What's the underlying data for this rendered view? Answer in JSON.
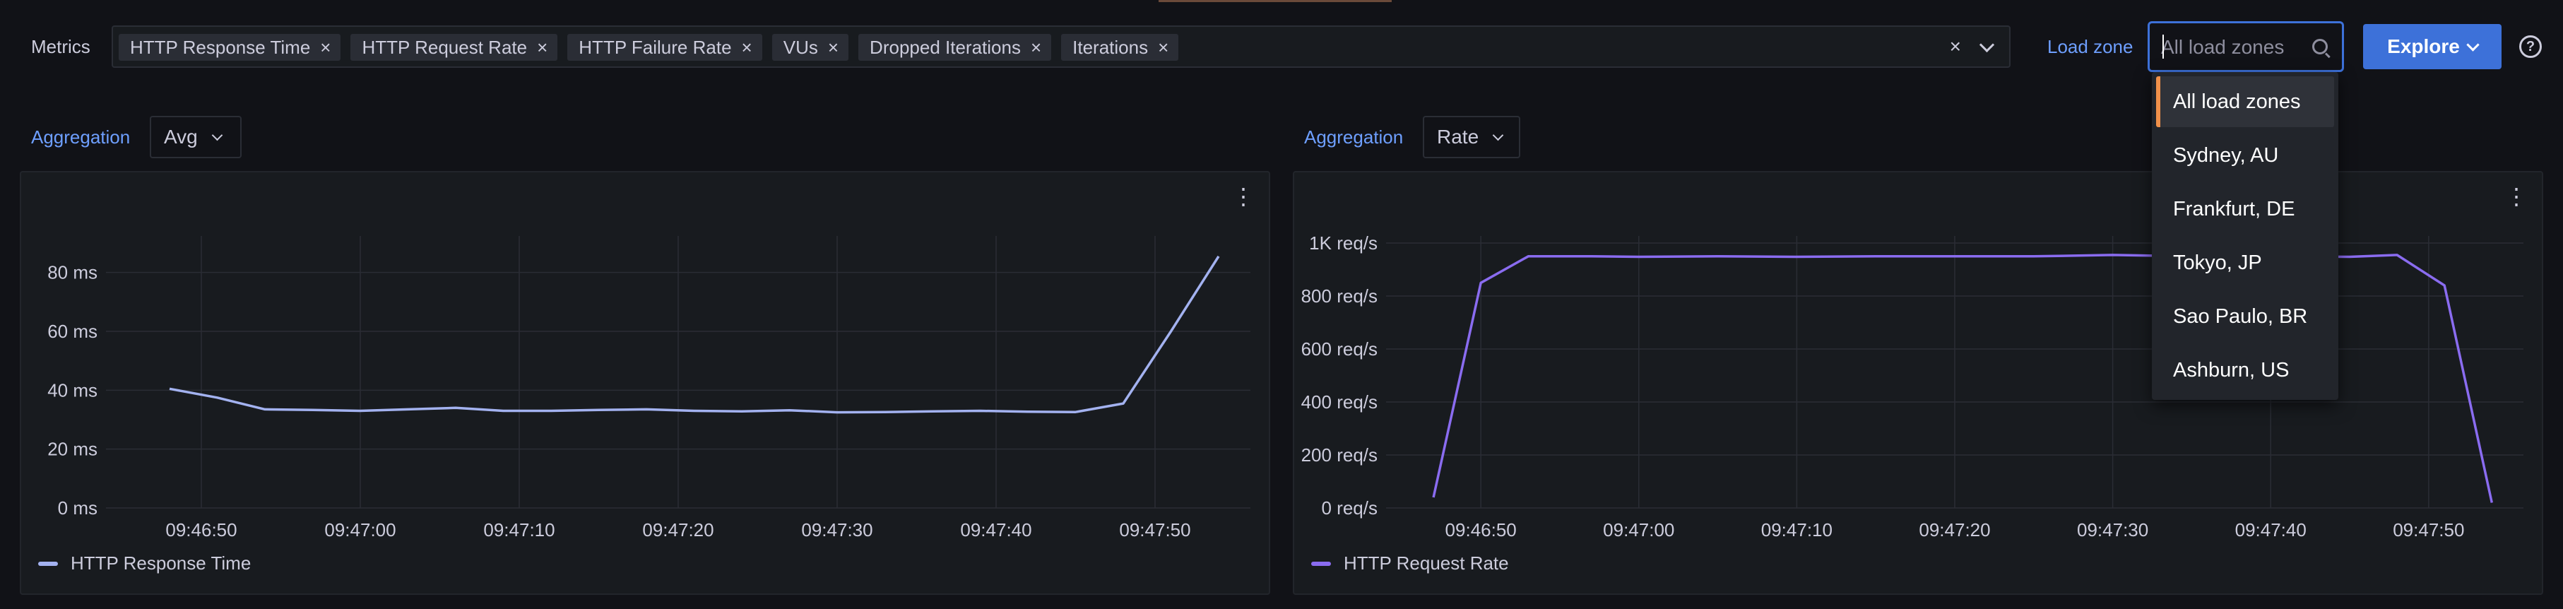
{
  "metrics": {
    "label": "Metrics",
    "chips": [
      "HTTP Response Time",
      "HTTP Request Rate",
      "HTTP Failure Rate",
      "VUs",
      "Dropped Iterations",
      "Iterations"
    ],
    "chip_remove": "×",
    "clear": "×"
  },
  "load_zone": {
    "label": "Load zone",
    "placeholder": "All load zones",
    "options": [
      "All load zones",
      "Sydney, AU",
      "Frankfurt, DE",
      "Tokyo, JP",
      "Sao Paulo, BR",
      "Ashburn, US"
    ],
    "selected": "All load zones"
  },
  "explore_label": "Explore",
  "help_glyph": "?",
  "kebab_glyph": "⋮",
  "left_panel": {
    "aggregation_label": "Aggregation",
    "aggregation_value": "Avg",
    "legend": "HTTP Response Time",
    "color": "#a3b2f0"
  },
  "right_panel": {
    "aggregation_label": "Aggregation",
    "aggregation_value": "Rate",
    "legend": "HTTP Request Rate",
    "color": "#8a6cf0"
  },
  "chart_data": [
    {
      "type": "line",
      "series": [
        {
          "name": "HTTP Response Time",
          "x": [
            "09:46:48",
            "09:46:51",
            "09:46:54",
            "09:46:57",
            "09:47:00",
            "09:47:03",
            "09:47:06",
            "09:47:09",
            "09:47:12",
            "09:47:15",
            "09:47:18",
            "09:47:21",
            "09:47:24",
            "09:47:27",
            "09:47:30",
            "09:47:33",
            "09:47:36",
            "09:47:39",
            "09:47:42",
            "09:47:45",
            "09:47:48",
            "09:47:51",
            "09:47:54"
          ],
          "values": [
            40.5,
            37.5,
            33.5,
            33.3,
            33.0,
            33.5,
            34.0,
            33.0,
            33.0,
            33.3,
            33.5,
            33.0,
            32.8,
            33.2,
            32.5,
            32.6,
            32.8,
            33.0,
            32.7,
            32.6,
            35.5,
            60,
            85.5
          ]
        }
      ],
      "x_ticks": [
        "09:46:50",
        "09:47:00",
        "09:47:10",
        "09:47:20",
        "09:47:30",
        "09:47:40",
        "09:47:50"
      ],
      "y_ticks": [
        "0 ms",
        "20 ms",
        "40 ms",
        "60 ms",
        "80 ms"
      ],
      "ylim": [
        0,
        90
      ],
      "grid": true,
      "legend_position": "bottom-left"
    },
    {
      "type": "line",
      "series": [
        {
          "name": "HTTP Request Rate",
          "x": [
            "09:46:47",
            "09:46:50",
            "09:46:53",
            "09:46:57",
            "09:47:00",
            "09:47:05",
            "09:47:10",
            "09:47:15",
            "09:47:20",
            "09:47:25",
            "09:47:30",
            "09:47:35",
            "09:47:40",
            "09:47:45",
            "09:47:48",
            "09:47:51",
            "09:47:54"
          ],
          "values": [
            40,
            850,
            950,
            950,
            948,
            950,
            948,
            950,
            950,
            950,
            955,
            950,
            950,
            948,
            955,
            840,
            20
          ]
        }
      ],
      "x_ticks": [
        "09:46:50",
        "09:47:00",
        "09:47:10",
        "09:47:20",
        "09:47:30",
        "09:47:40",
        "09:47:50"
      ],
      "y_ticks": [
        "0 req/s",
        "200 req/s",
        "400 req/s",
        "600 req/s",
        "800 req/s",
        "1K req/s"
      ],
      "ylim": [
        0,
        1000
      ],
      "grid": true,
      "legend_position": "bottom-left"
    }
  ]
}
